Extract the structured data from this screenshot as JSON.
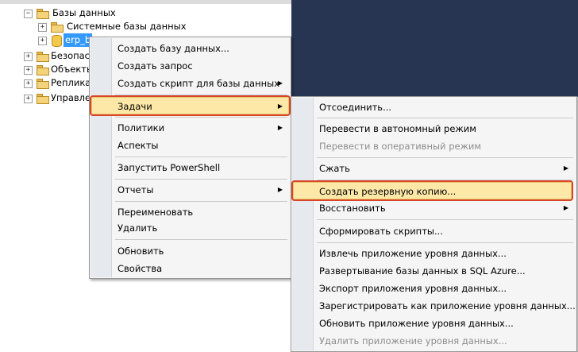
{
  "window": {
    "top_strip_text": ""
  },
  "tree": {
    "nodes": [
      {
        "label": "Базы данных",
        "expander": "−"
      },
      {
        "label": "Системные базы данных",
        "expander": "+"
      },
      {
        "label": "erp_b",
        "expander": "+"
      },
      {
        "label": "Безопасн",
        "expander": "+"
      },
      {
        "label": "Объекты",
        "expander": "+"
      },
      {
        "label": "Реплика",
        "expander": "+"
      },
      {
        "label": "Управле",
        "expander": "+"
      }
    ]
  },
  "context_menu": {
    "items": [
      {
        "label": "Создать базу данных..."
      },
      {
        "label": "Создать запрос"
      },
      {
        "label": "Создать скрипт для базы данных",
        "arrow": "▶"
      },
      {
        "label": "Задачи",
        "arrow": "▶"
      },
      {
        "label": "Политики",
        "arrow": "▶"
      },
      {
        "label": "Аспекты"
      },
      {
        "label": "Запустить PowerShell"
      },
      {
        "label": "Отчеты",
        "arrow": "▶"
      },
      {
        "label": "Переименовать"
      },
      {
        "label": "Удалить"
      },
      {
        "label": "Обновить"
      },
      {
        "label": "Свойства"
      }
    ]
  },
  "tasks_menu": {
    "items": [
      {
        "label": "Отсоединить..."
      },
      {
        "label": "Перевести в автономный режим"
      },
      {
        "label": "Перевести в оперативный режим",
        "disabled": true
      },
      {
        "label": "Сжать",
        "arrow": "▶"
      },
      {
        "label": "Создать резервную копию..."
      },
      {
        "label": "Восстановить",
        "arrow": "▶"
      },
      {
        "label": "Сформировать скрипты..."
      },
      {
        "label": "Извлечь приложение уровня данных..."
      },
      {
        "label": "Развертывание базы данных в SQL Azure..."
      },
      {
        "label": "Экспорт приложения уровня данных..."
      },
      {
        "label": "Зарегистрировать как приложение уровня данных..."
      },
      {
        "label": "Обновить приложение уровня данных..."
      },
      {
        "label": "Удалить приложение уровня данных...",
        "disabled": true
      }
    ]
  },
  "colors": {
    "dark_bg": "#283552",
    "highlight": "#fde8a8",
    "callout": "#d9452b"
  }
}
